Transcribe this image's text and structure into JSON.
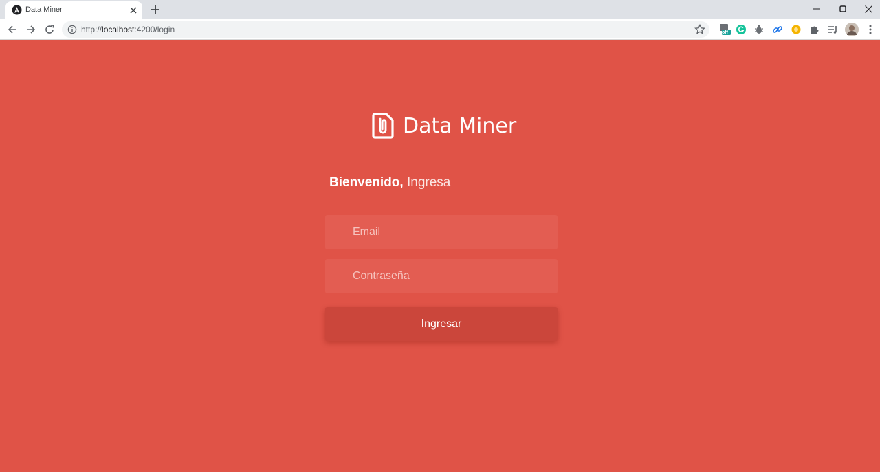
{
  "browser": {
    "tab_title": "Data Miner",
    "url_scheme": "http://",
    "url_host": "localhost",
    "url_rest": ":4200/login",
    "extension_badge": "off",
    "icons": {
      "favicon": "angular-icon",
      "close": "close-icon",
      "new_tab": "plus-icon",
      "back": "arrow-left-icon",
      "forward": "arrow-right-icon",
      "reload": "reload-icon",
      "site_info": "info-icon",
      "bookmark": "star-icon",
      "menu": "kebab-menu-icon"
    }
  },
  "page": {
    "brand_name": "Data Miner",
    "brand_icon": "clipped-file-icon",
    "welcome_bold": "Bienvenido,",
    "welcome_light": "Ingresa",
    "email_placeholder": "Email",
    "password_placeholder": "Contraseña",
    "submit_label": "Ingresar"
  },
  "colors": {
    "background": "#e05347",
    "field": "#e35d52",
    "button": "#cb463b",
    "text": "#ffffff"
  }
}
